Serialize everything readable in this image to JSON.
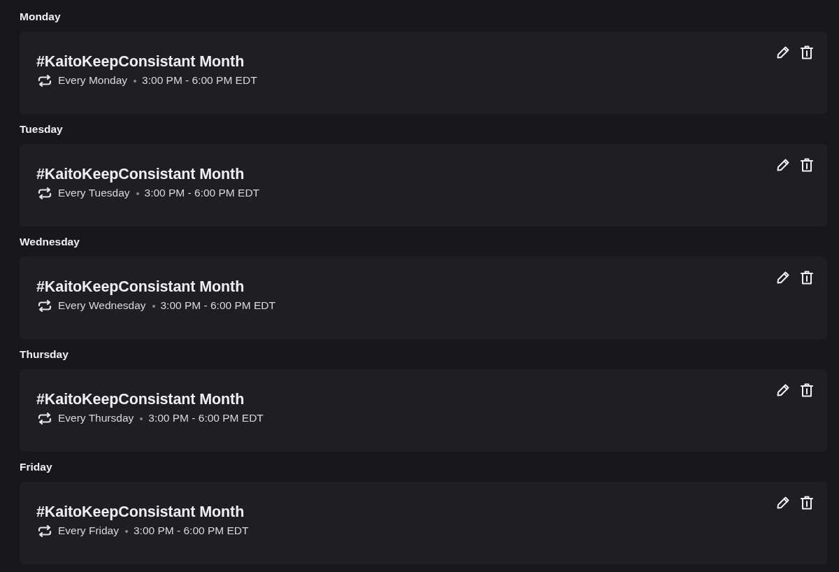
{
  "days": [
    {
      "label": "Monday",
      "events": [
        {
          "title": "#KaitoKeepConsistant Month",
          "recurrence": "Every Monday",
          "time": "3:00 PM - 6:00 PM EDT"
        }
      ]
    },
    {
      "label": "Tuesday",
      "events": [
        {
          "title": "#KaitoKeepConsistant Month",
          "recurrence": "Every Tuesday",
          "time": "3:00 PM - 6:00 PM EDT"
        }
      ]
    },
    {
      "label": "Wednesday",
      "events": [
        {
          "title": "#KaitoKeepConsistant Month",
          "recurrence": "Every Wednesday",
          "time": "3:00 PM - 6:00 PM EDT"
        }
      ]
    },
    {
      "label": "Thursday",
      "events": [
        {
          "title": "#KaitoKeepConsistant Month",
          "recurrence": "Every Thursday",
          "time": "3:00 PM - 6:00 PM EDT"
        }
      ]
    },
    {
      "label": "Friday",
      "events": [
        {
          "title": "#KaitoKeepConsistant Month",
          "recurrence": "Every Friday",
          "time": "3:00 PM - 6:00 PM EDT"
        }
      ]
    }
  ]
}
